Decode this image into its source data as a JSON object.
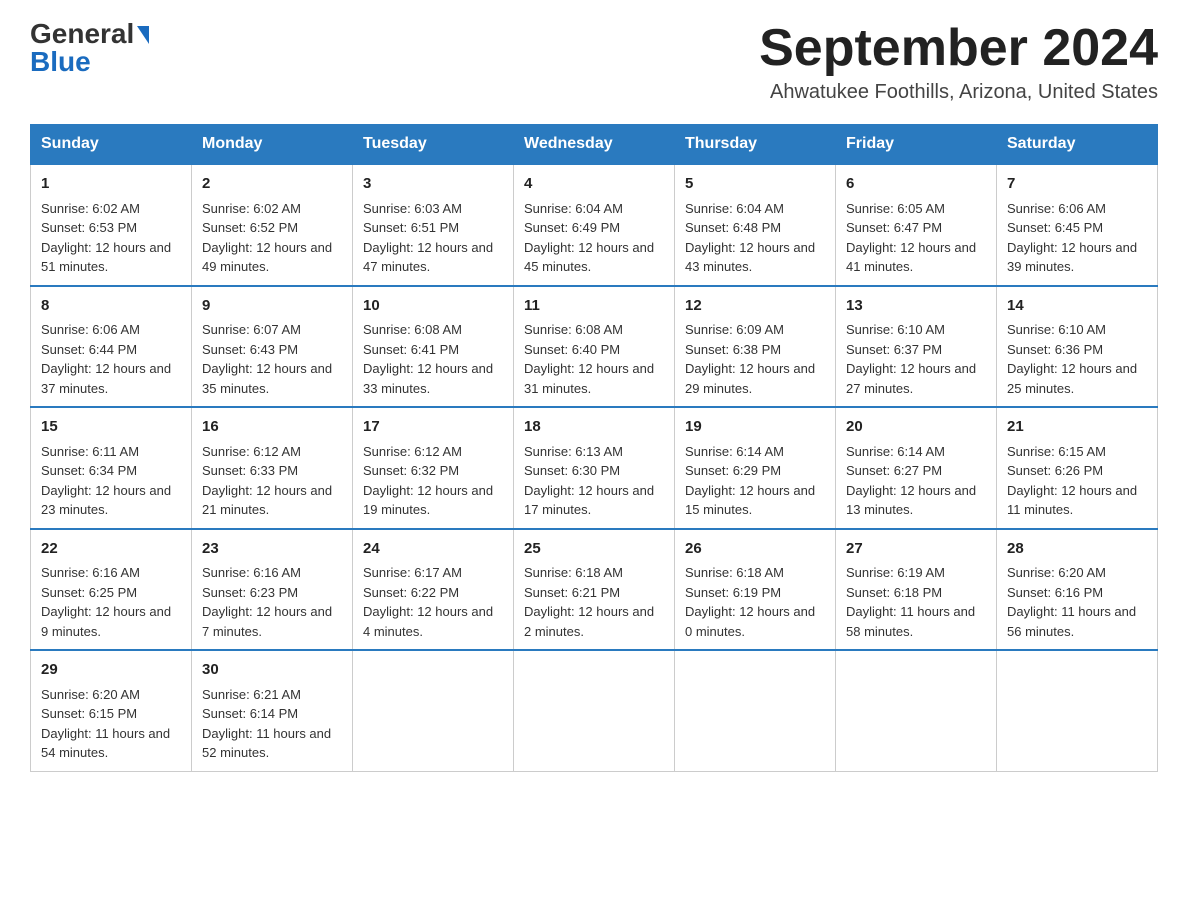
{
  "header": {
    "logo_general": "General",
    "logo_blue": "Blue",
    "month_title": "September 2024",
    "location": "Ahwatukee Foothills, Arizona, United States"
  },
  "days_of_week": [
    "Sunday",
    "Monday",
    "Tuesday",
    "Wednesday",
    "Thursday",
    "Friday",
    "Saturday"
  ],
  "weeks": [
    [
      {
        "day": "1",
        "sunrise": "6:02 AM",
        "sunset": "6:53 PM",
        "daylight": "12 hours and 51 minutes."
      },
      {
        "day": "2",
        "sunrise": "6:02 AM",
        "sunset": "6:52 PM",
        "daylight": "12 hours and 49 minutes."
      },
      {
        "day": "3",
        "sunrise": "6:03 AM",
        "sunset": "6:51 PM",
        "daylight": "12 hours and 47 minutes."
      },
      {
        "day": "4",
        "sunrise": "6:04 AM",
        "sunset": "6:49 PM",
        "daylight": "12 hours and 45 minutes."
      },
      {
        "day": "5",
        "sunrise": "6:04 AM",
        "sunset": "6:48 PM",
        "daylight": "12 hours and 43 minutes."
      },
      {
        "day": "6",
        "sunrise": "6:05 AM",
        "sunset": "6:47 PM",
        "daylight": "12 hours and 41 minutes."
      },
      {
        "day": "7",
        "sunrise": "6:06 AM",
        "sunset": "6:45 PM",
        "daylight": "12 hours and 39 minutes."
      }
    ],
    [
      {
        "day": "8",
        "sunrise": "6:06 AM",
        "sunset": "6:44 PM",
        "daylight": "12 hours and 37 minutes."
      },
      {
        "day": "9",
        "sunrise": "6:07 AM",
        "sunset": "6:43 PM",
        "daylight": "12 hours and 35 minutes."
      },
      {
        "day": "10",
        "sunrise": "6:08 AM",
        "sunset": "6:41 PM",
        "daylight": "12 hours and 33 minutes."
      },
      {
        "day": "11",
        "sunrise": "6:08 AM",
        "sunset": "6:40 PM",
        "daylight": "12 hours and 31 minutes."
      },
      {
        "day": "12",
        "sunrise": "6:09 AM",
        "sunset": "6:38 PM",
        "daylight": "12 hours and 29 minutes."
      },
      {
        "day": "13",
        "sunrise": "6:10 AM",
        "sunset": "6:37 PM",
        "daylight": "12 hours and 27 minutes."
      },
      {
        "day": "14",
        "sunrise": "6:10 AM",
        "sunset": "6:36 PM",
        "daylight": "12 hours and 25 minutes."
      }
    ],
    [
      {
        "day": "15",
        "sunrise": "6:11 AM",
        "sunset": "6:34 PM",
        "daylight": "12 hours and 23 minutes."
      },
      {
        "day": "16",
        "sunrise": "6:12 AM",
        "sunset": "6:33 PM",
        "daylight": "12 hours and 21 minutes."
      },
      {
        "day": "17",
        "sunrise": "6:12 AM",
        "sunset": "6:32 PM",
        "daylight": "12 hours and 19 minutes."
      },
      {
        "day": "18",
        "sunrise": "6:13 AM",
        "sunset": "6:30 PM",
        "daylight": "12 hours and 17 minutes."
      },
      {
        "day": "19",
        "sunrise": "6:14 AM",
        "sunset": "6:29 PM",
        "daylight": "12 hours and 15 minutes."
      },
      {
        "day": "20",
        "sunrise": "6:14 AM",
        "sunset": "6:27 PM",
        "daylight": "12 hours and 13 minutes."
      },
      {
        "day": "21",
        "sunrise": "6:15 AM",
        "sunset": "6:26 PM",
        "daylight": "12 hours and 11 minutes."
      }
    ],
    [
      {
        "day": "22",
        "sunrise": "6:16 AM",
        "sunset": "6:25 PM",
        "daylight": "12 hours and 9 minutes."
      },
      {
        "day": "23",
        "sunrise": "6:16 AM",
        "sunset": "6:23 PM",
        "daylight": "12 hours and 7 minutes."
      },
      {
        "day": "24",
        "sunrise": "6:17 AM",
        "sunset": "6:22 PM",
        "daylight": "12 hours and 4 minutes."
      },
      {
        "day": "25",
        "sunrise": "6:18 AM",
        "sunset": "6:21 PM",
        "daylight": "12 hours and 2 minutes."
      },
      {
        "day": "26",
        "sunrise": "6:18 AM",
        "sunset": "6:19 PM",
        "daylight": "12 hours and 0 minutes."
      },
      {
        "day": "27",
        "sunrise": "6:19 AM",
        "sunset": "6:18 PM",
        "daylight": "11 hours and 58 minutes."
      },
      {
        "day": "28",
        "sunrise": "6:20 AM",
        "sunset": "6:16 PM",
        "daylight": "11 hours and 56 minutes."
      }
    ],
    [
      {
        "day": "29",
        "sunrise": "6:20 AM",
        "sunset": "6:15 PM",
        "daylight": "11 hours and 54 minutes."
      },
      {
        "day": "30",
        "sunrise": "6:21 AM",
        "sunset": "6:14 PM",
        "daylight": "11 hours and 52 minutes."
      },
      null,
      null,
      null,
      null,
      null
    ]
  ],
  "labels": {
    "sunrise": "Sunrise:",
    "sunset": "Sunset:",
    "daylight": "Daylight:"
  }
}
